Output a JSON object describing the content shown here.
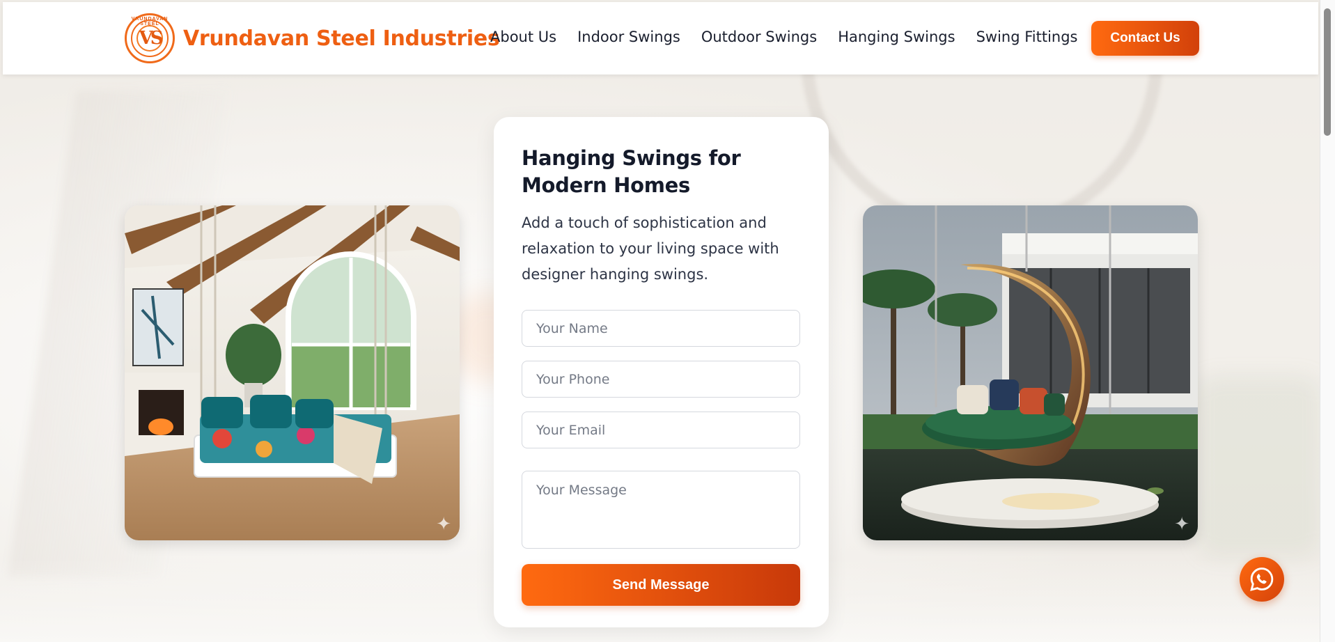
{
  "brand": {
    "name": "Vrundavan Steel Industries",
    "logo_letters": "VS",
    "logo_ring_text": "VRUNDAVAN STEEL",
    "accent_color": "#ee5f12"
  },
  "nav": {
    "items": [
      {
        "label": "About Us"
      },
      {
        "label": "Indoor Swings"
      },
      {
        "label": "Outdoor Swings"
      },
      {
        "label": "Hanging Swings"
      },
      {
        "label": "Swing Fittings"
      }
    ],
    "contact_label": "Contact Us"
  },
  "hero": {
    "title": "Hanging Swings for Modern Homes",
    "description": "Add a touch of sophistication and relaxation to your living space with designer hanging swings."
  },
  "form": {
    "name_placeholder": "Your Name",
    "phone_placeholder": "Your Phone",
    "email_placeholder": "Your Email",
    "message_placeholder": "Your Message",
    "submit_label": "Send Message"
  },
  "images": {
    "left": "indoor-hanging-swing-photo",
    "right": "outdoor-pod-swing-photo"
  },
  "floating": {
    "whatsapp_icon": "whatsapp-icon"
  }
}
